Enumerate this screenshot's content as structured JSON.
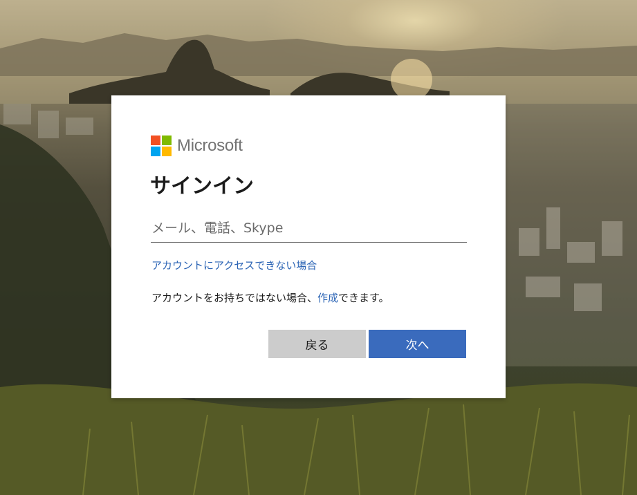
{
  "background": {
    "description_colors": {
      "sky": "#b7ab8c",
      "haze": "#8f8466",
      "city": "#55503e",
      "grass": "#4a4a22"
    }
  },
  "brand": {
    "name": "Microsoft",
    "colors": [
      "#f25022",
      "#7fba00",
      "#00a4ef",
      "#ffb900"
    ]
  },
  "signin": {
    "title": "サインイン",
    "email_placeholder": "メール、電話、Skype",
    "email_value": "",
    "cant_access_link": "アカウントにアクセスできない場合",
    "no_account_prefix": "アカウントをお持ちではない場合、",
    "create_link": "作成",
    "no_account_suffix": "できます。",
    "back_label": "戻る",
    "next_label": "次へ"
  },
  "colors": {
    "accent": "#3a6bbd",
    "link": "#2b64b5",
    "secondary_button": "#cccccc"
  }
}
